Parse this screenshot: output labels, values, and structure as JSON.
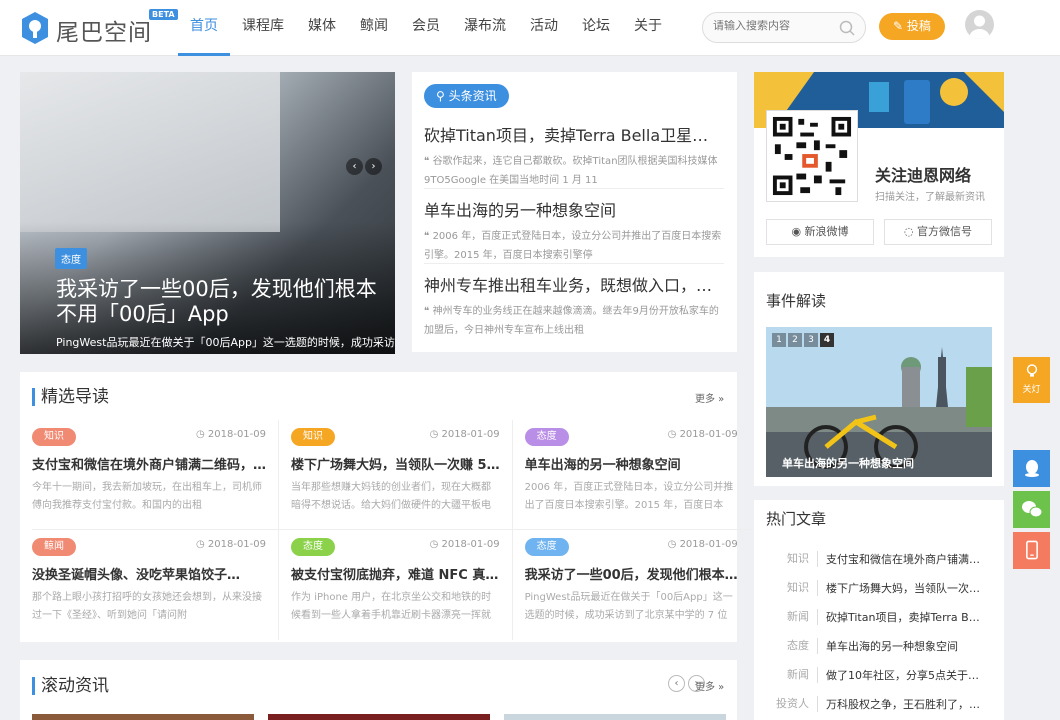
{
  "header": {
    "logo_text": "尾巴空间",
    "logo_badge": "BETA",
    "nav": [
      "首页",
      "课程库",
      "媒体",
      "鲸闻",
      "会员",
      "瀑布流",
      "活动",
      "论坛",
      "关于"
    ],
    "search_placeholder": "请输入搜索内容",
    "post_label": "投稿"
  },
  "slider": {
    "tag": "态度",
    "title": "我采访了一些00后，发现他们根本不用「00后」App",
    "desc": "PingWest品玩最近在做关于「00后App」这一选题的时候，成功采访到了北京某中学的 7 位",
    "prev": "‹",
    "next": "›"
  },
  "headlines": {
    "badge": "头条资讯",
    "items": [
      {
        "title": "砍掉Titan项目，卖掉Terra Bella卫星业务…",
        "desc": "谷歌作起来，连它自己都敢砍。砍掉Titan团队根据美国科技媒体9TO5Google 在美国当地时间 1 月 11"
      },
      {
        "title": "单车出海的另一种想象空间",
        "desc": "2006 年，百度正式登陆日本，设立分公司并推出了百度日本搜索引擎。2015 年，百度日本搜索引擎停"
      },
      {
        "title": "神州专车推出租车业务，既想做入口，又想…",
        "desc": "神州专车的业务线正在越来越像滴滴。继去年9月份开放私家车的加盟后，今日神州专车宣布上线出租"
      }
    ]
  },
  "featured": {
    "title": "精选导读",
    "more": "更多 »",
    "items": [
      {
        "cat": "知识",
        "color": "#f08a73",
        "date": "2018-01-09",
        "title": "支付宝和微信在境外商户铺满二维码，…",
        "desc": "今年十一期间，我去新加坡玩，在出租车上，司机师傅向我推荐支付宝付款。和国内的出租"
      },
      {
        "cat": "知识",
        "color": "#f5a623",
        "date": "2018-01-09",
        "title": "楼下广场舞大妈，当领队一次赚 5…",
        "desc": "当年那些想赚大妈钱的创业者们，现在大概都暗得不想说话。给大妈们做硬件的大疆平板电"
      },
      {
        "cat": "态度",
        "color": "#b98ee6",
        "date": "2018-01-09",
        "title": "单车出海的另一种想象空间",
        "desc": "2006 年，百度正式登陆日本，设立分公司并推出了百度日本搜索引擎。2015 年，百度日本"
      },
      {
        "cat": "鲸闻",
        "color": "#f08a73",
        "date": "2018-01-09",
        "title": "没换圣诞帽头像、没吃苹果馅饺子…",
        "desc": "那个路上眼小孩打招呼的女孩她还会想到，从来没接过一下《圣经》、听到她问「请问附"
      },
      {
        "cat": "态度",
        "color": "#8bd24a",
        "date": "2018-01-09",
        "title": "被支付宝彻底抛弃，难道 NFC 真…",
        "desc": "作为 iPhone 用户，在北京坐公交和地铁的时候看到一些人拿着手机靠近刷卡器漂亮一挥就"
      },
      {
        "cat": "态度",
        "color": "#6fb3f0",
        "date": "2018-01-09",
        "title": "我采访了一些00后，发现他们根本…",
        "desc": "PingWest品玩最近在做关于「00后App」这一选题的时候，成功采访到了北京某中学的 7 位"
      }
    ]
  },
  "scroll_news": {
    "title": "滚动资讯",
    "more": "更多 »",
    "prev": "‹",
    "next": "›"
  },
  "follow": {
    "name": "关注迪恩网络",
    "sub": "扫描关注，了解最新资讯",
    "weibo": "新浪微博",
    "wechat": "官方微信号"
  },
  "events": {
    "title": "事件解读",
    "pages": [
      "1",
      "2",
      "3",
      "4"
    ],
    "caption": "单车出海的另一种想象空间"
  },
  "hot": {
    "title": "热门文章",
    "items": [
      {
        "cat": "知识",
        "title": "支付宝和微信在境外商户铺满…"
      },
      {
        "cat": "知识",
        "title": "楼下广场舞大妈，当领队一次…"
      },
      {
        "cat": "新闻",
        "title": "砍掉Titan项目，卖掉Terra B…"
      },
      {
        "cat": "态度",
        "title": "单车出海的另一种想象空间"
      },
      {
        "cat": "新闻",
        "title": "做了10年社区，分享5点关于…"
      },
      {
        "cat": "投资人",
        "title": "万科股权之争，王石胜利了，…"
      }
    ]
  },
  "floating": {
    "lamp": "关灯"
  }
}
